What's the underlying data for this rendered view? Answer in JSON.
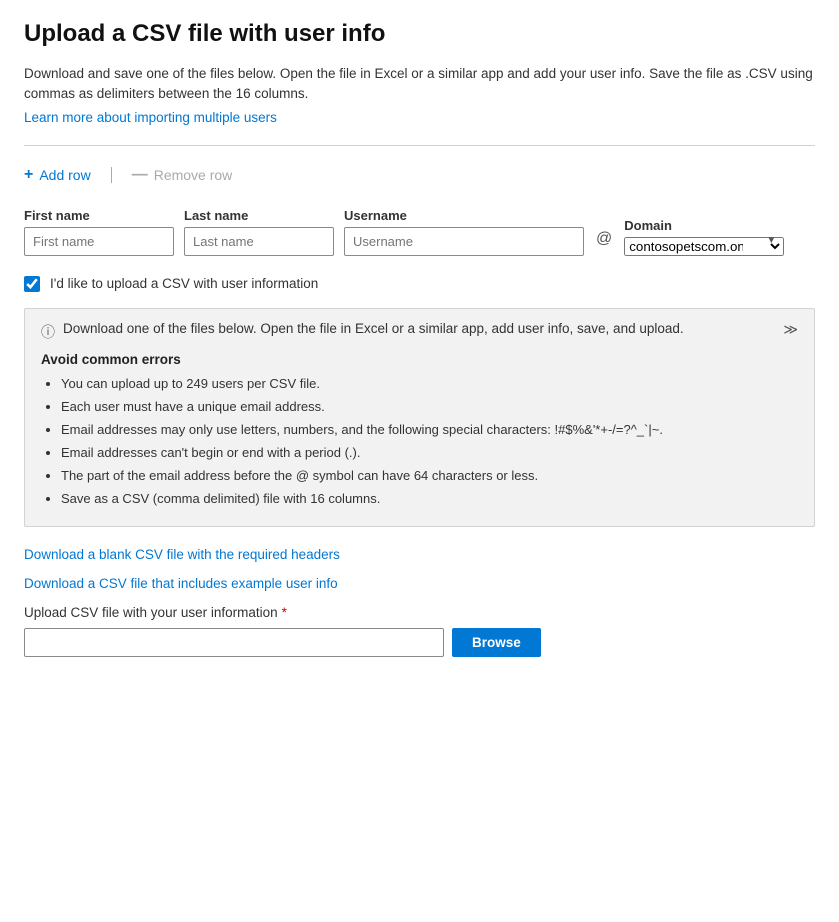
{
  "page": {
    "title": "Upload a CSV file with user info",
    "description": "Download and save one of the files below. Open the file in Excel or a similar app and add your user info. Save the file as .CSV using commas as delimiters between the 16 columns.",
    "learn_more_text": "Learn more about importing multiple users",
    "learn_more_url": "#"
  },
  "toolbar": {
    "add_row_label": "Add row",
    "remove_row_label": "Remove row"
  },
  "form": {
    "first_name_label": "First name",
    "first_name_placeholder": "First name",
    "last_name_label": "Last name",
    "last_name_placeholder": "Last name",
    "username_label": "Username",
    "username_placeholder": "Username",
    "at_symbol": "@",
    "domain_label": "Domain",
    "domain_value": "contosopetscom.onmic...",
    "domain_options": [
      "contosopetscom.onmic..."
    ]
  },
  "checkbox": {
    "label": "I'd like to upload a CSV with user information",
    "checked": true
  },
  "info_box": {
    "header_text": "Download one of the files below. Open the file in Excel or a similar app, add user info, save, and upload.",
    "section_title": "Avoid common errors",
    "bullets": [
      "You can upload up to 249 users per CSV file.",
      "Each user must have a unique email address.",
      "Email addresses may only use letters, numbers, and the following special characters: !#$%&'*+-/=?^_`|~.",
      "Email addresses can't begin or end with a period (.).",
      "The part of the email address before the @ symbol can have 64 characters or less.",
      "Save as a CSV (comma delimited) file with 16 columns."
    ]
  },
  "download": {
    "blank_csv_text": "Download a blank CSV file with the required headers",
    "example_csv_text": "Download a CSV file that includes example user info"
  },
  "upload": {
    "label": "Upload CSV file with your user information",
    "required_marker": "*",
    "browse_label": "Browse"
  }
}
